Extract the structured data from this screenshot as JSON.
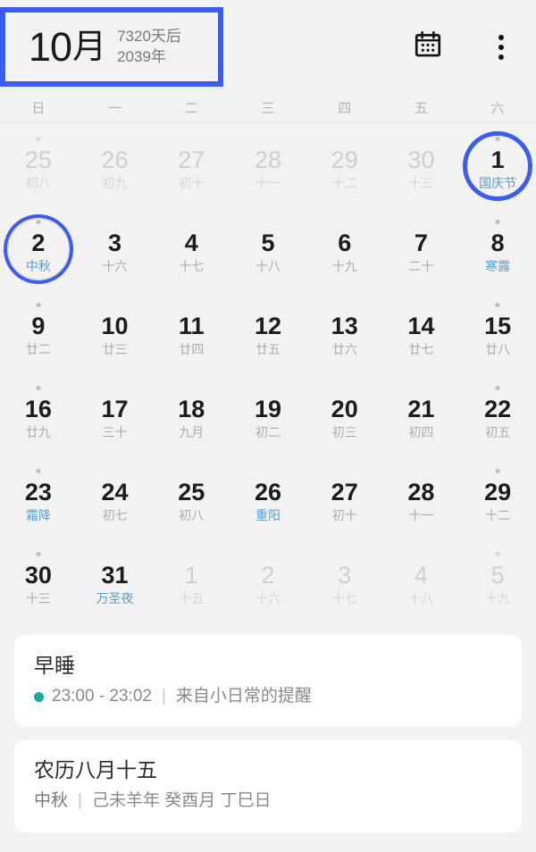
{
  "header": {
    "month_number": "10",
    "month_suffix": "月",
    "days_after": "7320天后",
    "year": "2039年",
    "calendar_icon": "calendar-icon",
    "overflow_icon": "more-vertical-icon"
  },
  "weekdays": [
    "日",
    "一",
    "二",
    "三",
    "四",
    "五",
    "六"
  ],
  "calendar": {
    "weeks": [
      [
        {
          "num": "25",
          "lunar": "初八",
          "out": true,
          "dot": true,
          "fest": false,
          "ring": false
        },
        {
          "num": "26",
          "lunar": "初九",
          "out": true,
          "dot": false,
          "fest": false,
          "ring": false
        },
        {
          "num": "27",
          "lunar": "初十",
          "out": true,
          "dot": false,
          "fest": false,
          "ring": false
        },
        {
          "num": "28",
          "lunar": "十一",
          "out": true,
          "dot": false,
          "fest": false,
          "ring": false
        },
        {
          "num": "29",
          "lunar": "十二",
          "out": true,
          "dot": false,
          "fest": false,
          "ring": false
        },
        {
          "num": "30",
          "lunar": "十三",
          "out": true,
          "dot": false,
          "fest": false,
          "ring": false
        },
        {
          "num": "1",
          "lunar": "国庆节",
          "out": false,
          "dot": true,
          "fest": true,
          "ring": true
        }
      ],
      [
        {
          "num": "2",
          "lunar": "中秋",
          "out": false,
          "dot": true,
          "fest": true,
          "ring": true,
          "ring_inner": true
        },
        {
          "num": "3",
          "lunar": "十六",
          "out": false,
          "dot": false,
          "fest": false,
          "ring": false
        },
        {
          "num": "4",
          "lunar": "十七",
          "out": false,
          "dot": false,
          "fest": false,
          "ring": false
        },
        {
          "num": "5",
          "lunar": "十八",
          "out": false,
          "dot": false,
          "fest": false,
          "ring": false
        },
        {
          "num": "6",
          "lunar": "十九",
          "out": false,
          "dot": false,
          "fest": false,
          "ring": false
        },
        {
          "num": "7",
          "lunar": "二十",
          "out": false,
          "dot": false,
          "fest": false,
          "ring": false
        },
        {
          "num": "8",
          "lunar": "寒露",
          "out": false,
          "dot": true,
          "fest": true,
          "ring": false
        }
      ],
      [
        {
          "num": "9",
          "lunar": "廿二",
          "out": false,
          "dot": true,
          "fest": false,
          "ring": false
        },
        {
          "num": "10",
          "lunar": "廿三",
          "out": false,
          "dot": false,
          "fest": false,
          "ring": false
        },
        {
          "num": "11",
          "lunar": "廿四",
          "out": false,
          "dot": false,
          "fest": false,
          "ring": false
        },
        {
          "num": "12",
          "lunar": "廿五",
          "out": false,
          "dot": false,
          "fest": false,
          "ring": false
        },
        {
          "num": "13",
          "lunar": "廿六",
          "out": false,
          "dot": false,
          "fest": false,
          "ring": false
        },
        {
          "num": "14",
          "lunar": "廿七",
          "out": false,
          "dot": false,
          "fest": false,
          "ring": false
        },
        {
          "num": "15",
          "lunar": "廿八",
          "out": false,
          "dot": true,
          "fest": false,
          "ring": false
        }
      ],
      [
        {
          "num": "16",
          "lunar": "廿九",
          "out": false,
          "dot": true,
          "fest": false,
          "ring": false
        },
        {
          "num": "17",
          "lunar": "三十",
          "out": false,
          "dot": false,
          "fest": false,
          "ring": false
        },
        {
          "num": "18",
          "lunar": "九月",
          "out": false,
          "dot": false,
          "fest": false,
          "ring": false
        },
        {
          "num": "19",
          "lunar": "初二",
          "out": false,
          "dot": false,
          "fest": false,
          "ring": false
        },
        {
          "num": "20",
          "lunar": "初三",
          "out": false,
          "dot": false,
          "fest": false,
          "ring": false
        },
        {
          "num": "21",
          "lunar": "初四",
          "out": false,
          "dot": false,
          "fest": false,
          "ring": false
        },
        {
          "num": "22",
          "lunar": "初五",
          "out": false,
          "dot": true,
          "fest": false,
          "ring": false
        }
      ],
      [
        {
          "num": "23",
          "lunar": "霜降",
          "out": false,
          "dot": true,
          "fest": true,
          "ring": false
        },
        {
          "num": "24",
          "lunar": "初七",
          "out": false,
          "dot": false,
          "fest": false,
          "ring": false
        },
        {
          "num": "25",
          "lunar": "初八",
          "out": false,
          "dot": false,
          "fest": false,
          "ring": false
        },
        {
          "num": "26",
          "lunar": "重阳",
          "out": false,
          "dot": false,
          "fest": true,
          "ring": false
        },
        {
          "num": "27",
          "lunar": "初十",
          "out": false,
          "dot": false,
          "fest": false,
          "ring": false
        },
        {
          "num": "28",
          "lunar": "十一",
          "out": false,
          "dot": false,
          "fest": false,
          "ring": false
        },
        {
          "num": "29",
          "lunar": "十二",
          "out": false,
          "dot": true,
          "fest": false,
          "ring": false
        }
      ],
      [
        {
          "num": "30",
          "lunar": "十三",
          "out": false,
          "dot": true,
          "fest": false,
          "ring": false
        },
        {
          "num": "31",
          "lunar": "万圣夜",
          "out": false,
          "dot": false,
          "fest": true,
          "ring": false
        },
        {
          "num": "1",
          "lunar": "十五",
          "out": true,
          "dot": false,
          "fest": false,
          "ring": false
        },
        {
          "num": "2",
          "lunar": "十六",
          "out": true,
          "dot": false,
          "fest": false,
          "ring": false
        },
        {
          "num": "3",
          "lunar": "十七",
          "out": true,
          "dot": false,
          "fest": false,
          "ring": false
        },
        {
          "num": "4",
          "lunar": "十八",
          "out": true,
          "dot": false,
          "fest": false,
          "ring": false
        },
        {
          "num": "5",
          "lunar": "十九",
          "out": true,
          "dot": true,
          "fest": false,
          "ring": false
        }
      ]
    ]
  },
  "cards": [
    {
      "title": "早睡",
      "has_dot": true,
      "dot_color": "#19a9a0",
      "time": "23:00 - 23:02",
      "separator": "|",
      "source": "来自小日常的提醒"
    },
    {
      "title": "农历八月十五",
      "has_dot": false,
      "lunar_festival": "中秋",
      "separator": "|",
      "ganzhi": "己未羊年 癸酉月 丁巳日"
    }
  ],
  "colors": {
    "accent_blue": "#3b5cf0",
    "festival_teal": "#5b9ec9",
    "event_dot_teal": "#19a9a0",
    "background": "#f2f2f2",
    "card": "#ffffff"
  }
}
